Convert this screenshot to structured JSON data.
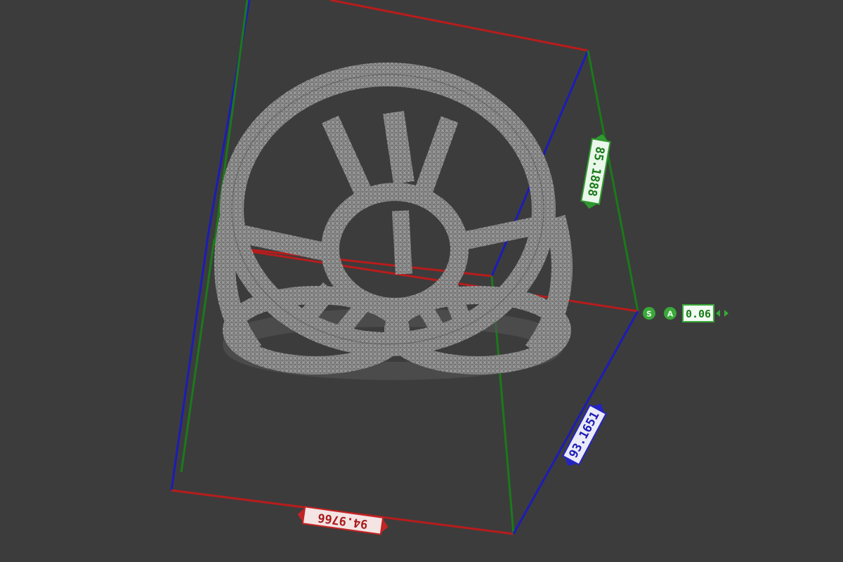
{
  "viewport": {
    "background": "#3c3c3c",
    "axis_colors": {
      "x": "#b81c1c",
      "y": "#1a7a1a",
      "z": "#1c1cb8"
    },
    "mesh_color": "#8e8e8e"
  },
  "dimensions": {
    "width_label": "94.9766",
    "height_label": "85.1888",
    "depth_label": "93.1651"
  },
  "scale_control": {
    "s_icon": "S",
    "a_icon": "A",
    "value": "0.06",
    "accent": "#3aa83a"
  }
}
